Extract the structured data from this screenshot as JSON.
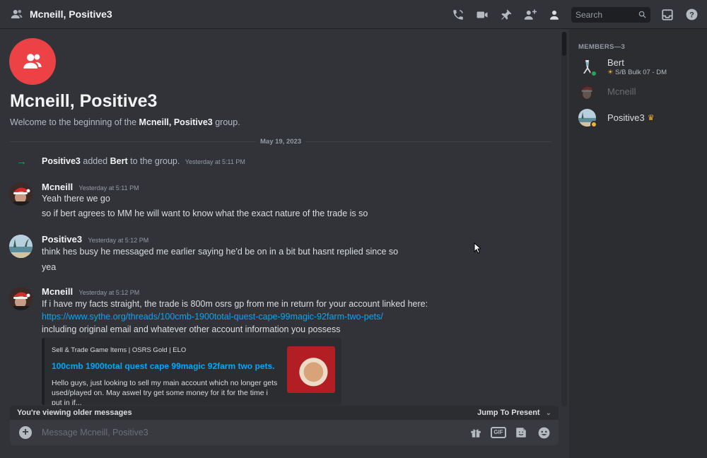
{
  "header": {
    "title": "Mcneill, Positive3",
    "search_placeholder": "Search"
  },
  "welcome": {
    "title": "Mcneill, Positive3",
    "sub_prefix": "Welcome to the beginning of the ",
    "sub_group": "Mcneill, Positive3",
    "sub_suffix": " group."
  },
  "date_divider": "May 19, 2023",
  "system_message": {
    "actor": "Positive3",
    "action": "added",
    "target": "Bert",
    "rest": "to the group.",
    "timestamp": "Yesterday at 5:11 PM"
  },
  "messages": [
    {
      "author": "Mcneill",
      "timestamp": "Yesterday at 5:11 PM",
      "lines": [
        "Yeah there we go",
        "so if bert agrees to MM he will want to know what the exact nature of the trade is so"
      ]
    },
    {
      "author": "Positive3",
      "timestamp": "Yesterday at 5:12 PM",
      "lines": [
        "think hes busy he messaged me earlier saying he'd be on in a bit but hasnt replied since so",
        "yea"
      ]
    },
    {
      "author": "Mcneill",
      "timestamp": "Yesterday at 5:12 PM",
      "lines": [
        "If i have my facts straight, the trade is 800m osrs gp from me in return for your account linked here:",
        "https://www.sythe.org/threads/100cmb-1900total-quest-cape-99magic-92farm-two-pets/",
        "including original email and whatever other account information you possess"
      ]
    }
  ],
  "embed": {
    "provider": "Sell & Trade Game Items | OSRS Gold | ELO",
    "title": "100cmb 1900total quest cape 99magic 92farm two pets.",
    "description": "Hello guys, just looking to sell my main account which no longer gets used/played on. May aswel try get some money for it for the time i put in if..."
  },
  "older_bar": {
    "label": "You're viewing older messages",
    "jump": "Jump To Present"
  },
  "composer": {
    "placeholder": "Message Mcneill, Positive3",
    "gif_label": "GIF"
  },
  "members": {
    "title": "MEMBERS—3",
    "list": [
      {
        "name": "Bert",
        "activity": "S/B Bulk 07 - DM",
        "status": "online",
        "owner": false
      },
      {
        "name": "Mcneill",
        "activity": "",
        "status": "offline",
        "owner": false
      },
      {
        "name": "Positive3",
        "activity": "",
        "status": "idle",
        "owner": true
      }
    ]
  },
  "colors": {
    "accent_red": "#ed4245",
    "link": "#00a8fc",
    "online": "#23a55a",
    "idle": "#f0b232",
    "bg_chat": "#313338",
    "bg_sidebar": "#2b2d31"
  }
}
